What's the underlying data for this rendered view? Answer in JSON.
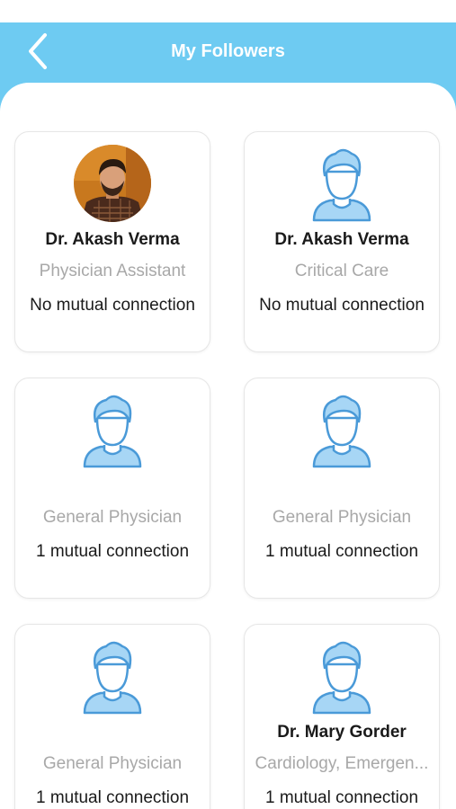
{
  "header": {
    "title": "My Followers",
    "back_icon": "chevron-left-icon",
    "background_color": "#6ecbf2"
  },
  "followers": [
    {
      "name": "Dr. Akash Verma",
      "specialty": "Physician Assistant",
      "mutual": "No mutual connection",
      "avatar": "profile-photo"
    },
    {
      "name": "Dr. Akash Verma",
      "specialty": "Critical Care",
      "mutual": "No mutual connection",
      "avatar": "default-user-icon"
    },
    {
      "name": "",
      "specialty": "General Physician",
      "mutual": "1 mutual connection",
      "avatar": "default-user-icon"
    },
    {
      "name": "",
      "specialty": "General Physician",
      "mutual": "1 mutual connection",
      "avatar": "default-user-icon"
    },
    {
      "name": "",
      "specialty": "General Physician",
      "mutual": "1 mutual connection",
      "avatar": "default-user-icon"
    },
    {
      "name": "Dr. Mary Gorder",
      "specialty": "Cardiology, Emergen...",
      "mutual": "1 mutual connection",
      "avatar": "default-user-icon"
    }
  ]
}
